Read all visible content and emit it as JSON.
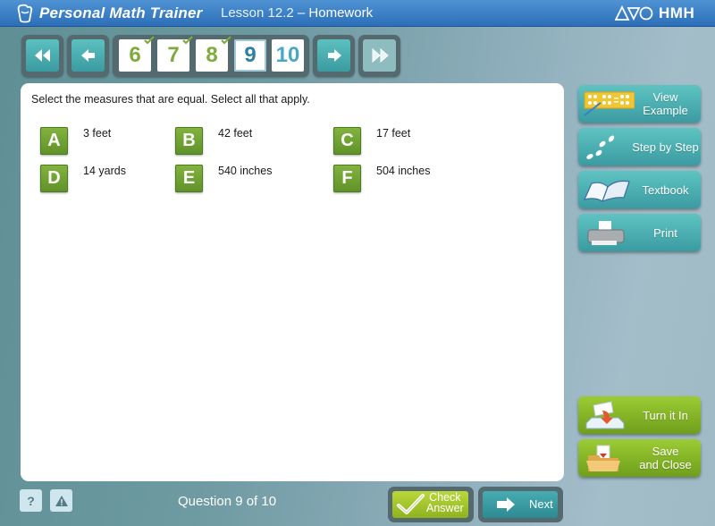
{
  "header": {
    "app_name": "Personal Math Trainer",
    "lesson_prefix": "Lesson 12.2",
    "lesson_separator": " – ",
    "lesson_kind": "Homework",
    "brand": "HMH",
    "logo_icon": "pmt-logo-icon",
    "brand_icon": "hmh-shapes-icon"
  },
  "navigation": {
    "first_icon": "double-chevron-left-icon",
    "prev_icon": "arrow-left-icon",
    "next_icon": "arrow-right-icon",
    "last_icon": "double-chevron-right-icon",
    "questions": [
      {
        "number": "6",
        "status": "completed"
      },
      {
        "number": "7",
        "status": "completed"
      },
      {
        "number": "8",
        "status": "completed"
      },
      {
        "number": "9",
        "status": "current"
      },
      {
        "number": "10",
        "status": "not-started"
      }
    ]
  },
  "question": {
    "prompt": "Select the measures that are equal. Select all that apply.",
    "choices": [
      {
        "letter": "A",
        "text": "3 feet"
      },
      {
        "letter": "B",
        "text": "42 feet"
      },
      {
        "letter": "C",
        "text": "17 feet"
      },
      {
        "letter": "D",
        "text": "14 yards"
      },
      {
        "letter": "E",
        "text": "540 inches"
      },
      {
        "letter": "F",
        "text": "504 inches"
      }
    ]
  },
  "tools": {
    "view_example": "View Example",
    "view_example_line1": "View",
    "view_example_line2": "Example",
    "step_by_step": "Step by Step",
    "textbook": "Textbook",
    "print": "Print",
    "turn_it_in": "Turn it In",
    "save_close_line1": "Save",
    "save_close_line2": "and Close"
  },
  "footer": {
    "help_label": "?",
    "report_label": "!",
    "question_count": "Question 9 of 10",
    "check_answer_line1": "Check",
    "check_answer_line2": "Answer",
    "next": "Next"
  },
  "colors": {
    "title_bar": "#2c6fb8",
    "teal_button": "#3a9ba0",
    "green_button": "#6f9e1c",
    "choice_badge": "#6c9e2f",
    "completed_number": "#7faa3c",
    "current_number": "#2f7f9e"
  }
}
